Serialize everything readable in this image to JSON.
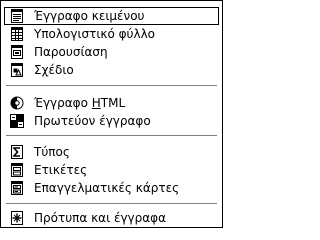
{
  "menu": {
    "groups": [
      {
        "items": [
          {
            "label": "Έγγραφο κειμένου",
            "icon": "text-document-icon",
            "selected": true
          },
          {
            "label": "Υπολογιστικό φύλλο",
            "icon": "spreadsheet-icon"
          },
          {
            "label": "Παρουσίαση",
            "icon": "presentation-icon"
          },
          {
            "label": "Σχέδιο",
            "icon": "drawing-icon"
          }
        ]
      },
      {
        "items": [
          {
            "label_pre": "Έγγραφο ",
            "label_ul": "H",
            "label_post": "TML",
            "icon": "html-document-icon"
          },
          {
            "label": "Πρωτεύον έγγραφο",
            "icon": "master-document-icon"
          }
        ]
      },
      {
        "items": [
          {
            "label": "Τύπος",
            "icon": "formula-icon"
          },
          {
            "label": "Ετικέτες",
            "icon": "labels-icon"
          },
          {
            "label": "Επαγγελματικές κάρτες",
            "icon": "business-cards-icon"
          }
        ]
      },
      {
        "items": [
          {
            "label": "Πρότυπα και έγγραφα",
            "icon": "templates-icon"
          }
        ]
      }
    ]
  }
}
